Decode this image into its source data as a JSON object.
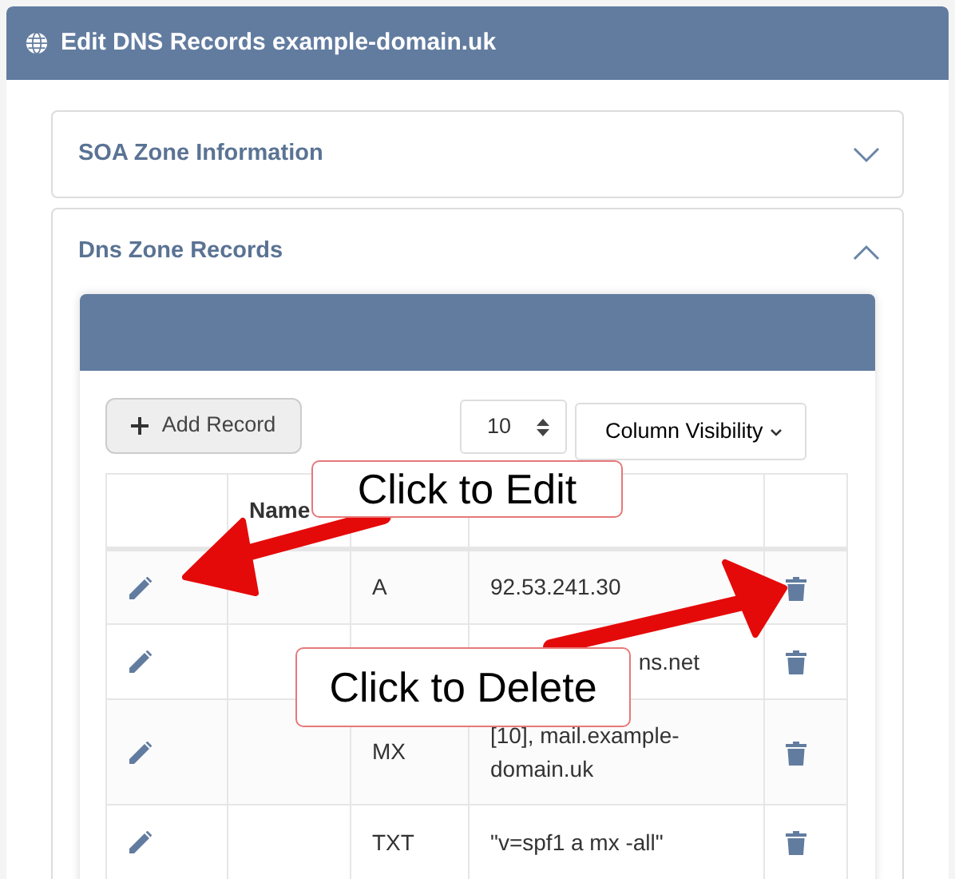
{
  "title": "Edit DNS Records example-domain.uk",
  "sections": [
    {
      "title": "SOA Zone Information",
      "expanded": false
    },
    {
      "title": "Dns Zone Records",
      "expanded": true
    }
  ],
  "toolbar": {
    "add_button": "Add Record",
    "page_size": "10",
    "column_visibility": "Column Visibility"
  },
  "table": {
    "name_header": "Name",
    "rows": [
      {
        "type": "A",
        "data": "92.53.241.30",
        "covered": false
      },
      {
        "data": "ns.net",
        "covered": true
      },
      {
        "type": "MX",
        "data": "[10], mail.example-domain.uk",
        "covered": false
      },
      {
        "type": "TXT",
        "data": "\"v=spf1 a mx -all\"",
        "covered": false
      }
    ]
  },
  "annotations": [
    {
      "kind": "edit",
      "text": "Click to Edit"
    },
    {
      "kind": "delete",
      "text": "Click to Delete"
    }
  ]
}
